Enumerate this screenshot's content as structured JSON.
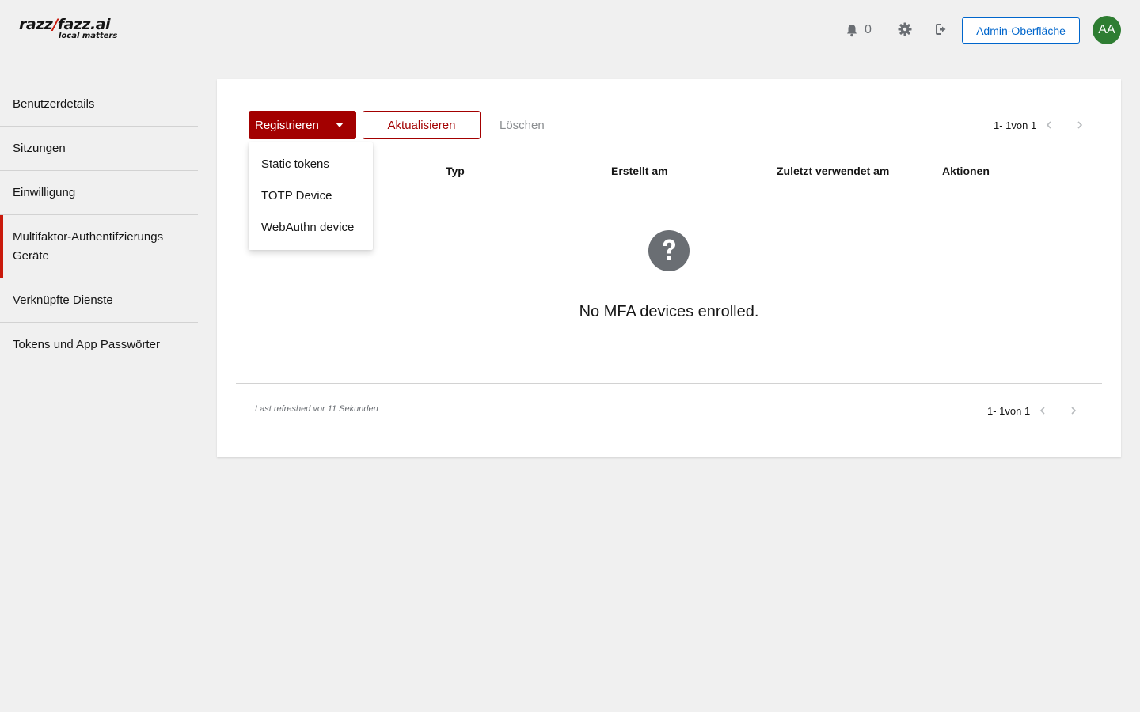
{
  "header": {
    "logo_brand_left": "razz",
    "logo_brand_bolt": "/",
    "logo_brand_right": "fazz.ai",
    "logo_tagline": "local matters",
    "notification_count": "0",
    "admin_button": "Admin-Oberfläche",
    "avatar_initials": "AA"
  },
  "sidebar": {
    "items": [
      {
        "label": "Benutzerdetails"
      },
      {
        "label": "Sitzungen"
      },
      {
        "label": "Einwilligung"
      },
      {
        "label": "Multifaktor-Authentifzierungs Geräte"
      },
      {
        "label": "Verknüpfte Dienste"
      },
      {
        "label": "Tokens und App Passwörter"
      }
    ]
  },
  "toolbar": {
    "register_label": "Registrieren",
    "refresh_label": "Aktualisieren",
    "delete_label": "Löschen",
    "pagination": "1- 1von 1"
  },
  "dropdown": {
    "items": [
      {
        "label": "Static tokens"
      },
      {
        "label": "TOTP Device"
      },
      {
        "label": "WebAuthn device"
      }
    ]
  },
  "table": {
    "columns": [
      "Typ",
      "Erstellt am",
      "Zuletzt verwendet am",
      "Aktionen"
    ],
    "empty_message": "No MFA devices enrolled."
  },
  "footer": {
    "last_refreshed": "Last refreshed vor 11 Sekunden",
    "pagination": "1- 1von 1"
  },
  "colors": {
    "primary": "#a30000",
    "active_indicator": "#c9190b",
    "link": "#0066cc",
    "avatar": "#2e7d32",
    "background": "#f0f0f0"
  }
}
